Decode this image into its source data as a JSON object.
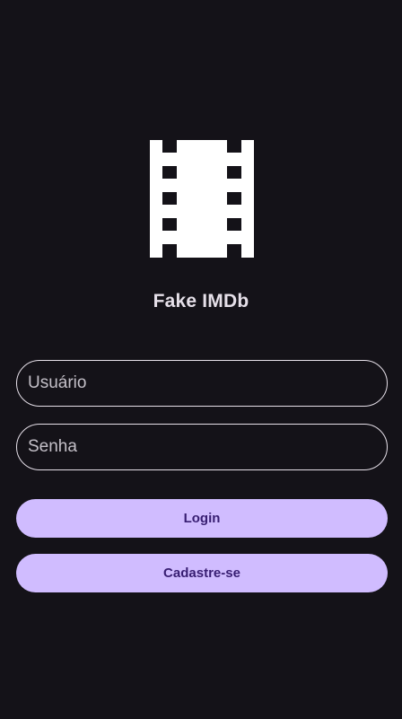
{
  "app": {
    "title": "Fake IMDb",
    "logo_icon": "film-strip-icon"
  },
  "form": {
    "username_placeholder": "Usuário",
    "username_value": "",
    "password_placeholder": "Senha",
    "password_value": ""
  },
  "actions": {
    "login_label": "Login",
    "signup_label": "Cadastre-se"
  },
  "colors": {
    "background": "#141218",
    "primary_container": "#d0bcff",
    "on_primary": "#381e72",
    "outline": "#e6e0e9"
  }
}
